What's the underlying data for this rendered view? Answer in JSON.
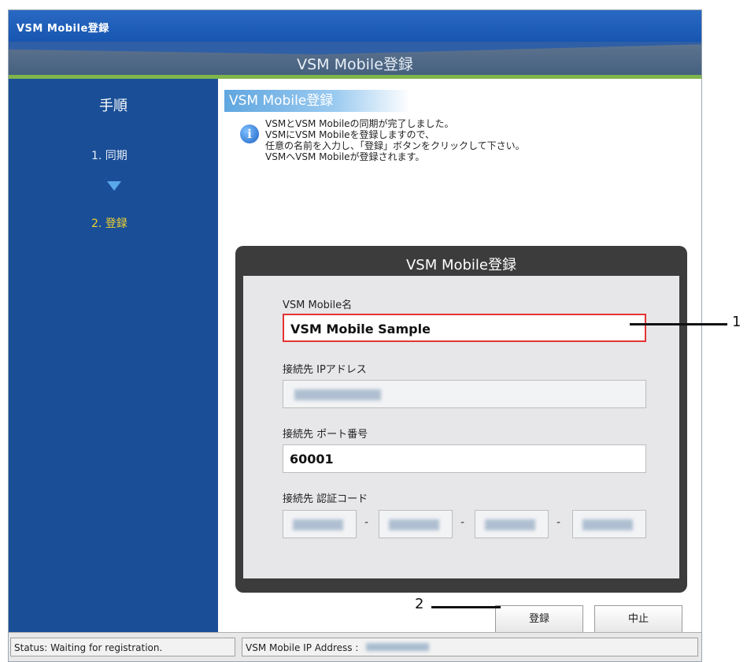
{
  "window": {
    "title": "VSM Mobile登録"
  },
  "banner": {
    "title": "VSM Mobile登録"
  },
  "sidebar": {
    "heading": "手順",
    "steps": [
      {
        "label": "1. 同期"
      },
      {
        "label": "2. 登録"
      }
    ]
  },
  "main": {
    "section_title": "VSM Mobile登録",
    "info_lines": [
      "VSMとVSM Mobileの同期が完了しました。",
      "VSMにVSM Mobileを登録しますので、",
      "任意の名前を入力し、「登録」ボタンをクリックして下さい。",
      "VSMへVSM Mobileが登録されます。"
    ],
    "panel": {
      "title": "VSM Mobile登録",
      "name_label": "VSM Mobile名",
      "name_value": "VSM Mobile Sample",
      "ip_label": "接続先 IPアドレス",
      "port_label": "接続先 ポート番号",
      "port_value": "60001",
      "code_label": "接続先 認証コード",
      "code_separator": "-"
    },
    "buttons": {
      "register": "登録",
      "cancel": "中止"
    }
  },
  "status": {
    "left": "Status: Waiting for registration.",
    "right": "VSM Mobile IP Address :"
  },
  "callouts": {
    "one": "1",
    "two": "2"
  },
  "colors": {
    "titlebar": "#1756b0",
    "sidebar": "#1a4f97",
    "accent_green": "#7fb54b",
    "active_step": "#f0d230",
    "highlight_border": "#e43434"
  }
}
